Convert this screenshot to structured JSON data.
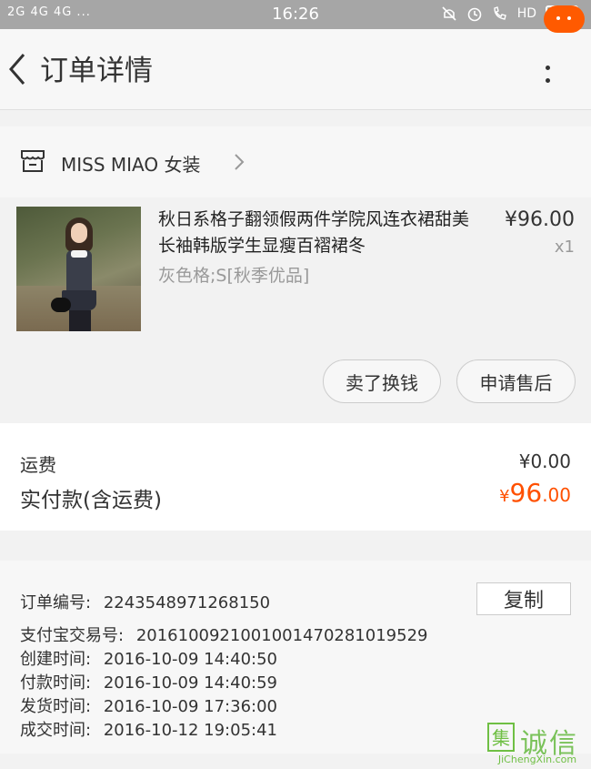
{
  "status_bar": {
    "left": "2G 4G 4G ...",
    "time": "16:26",
    "hd": "HD"
  },
  "header": {
    "title": "订单详情"
  },
  "shop": {
    "name": "MISS MIAO 女装"
  },
  "item": {
    "title": "秋日系格子翻领假两件学院风连衣裙甜美长袖韩版学生显瘦百褶裙冬",
    "sku": "灰色格;S[秋季优品]",
    "price": "¥96.00",
    "qty": "x1",
    "buttons": {
      "sell": "卖了换钱",
      "after_sale": "申请售后"
    }
  },
  "totals": {
    "shipping_label": "运费",
    "shipping_value": "¥0.00",
    "paid_label": "实付款(含运费)",
    "paid_currency": "¥",
    "paid_integer": "96",
    "paid_decimal": ".00"
  },
  "order_info": {
    "copy_label": "复制",
    "order_no_label": "订单编号:",
    "order_no": "2243548971268150",
    "alipay_label": "支付宝交易号:",
    "alipay_no": "2016100921001001470281019529",
    "created_label": "创建时间:",
    "created": "2016-10-09  14:40:50",
    "paid_label": "付款时间:",
    "paid": "2016-10-09  14:40:59",
    "shipped_label": "发货时间:",
    "shipped": "2016-10-09  17:36:00",
    "completed_label": "成交时间:",
    "completed": "2016-10-12  19:05:41"
  },
  "watermark": {
    "glyph": "集",
    "text": "诚信",
    "sub": "JiChengXin.com"
  },
  "icons": [
    "signal-icon",
    "mute-icon",
    "alarm-icon",
    "call-icon",
    "battery-icon",
    "back-arrow-icon",
    "more-menu-icon",
    "message-icon",
    "shop-icon",
    "chevron-right-icon"
  ],
  "colors": {
    "accent": "#ff5000",
    "status_bar": "#a6a6a6",
    "battery": "#33cc33"
  }
}
